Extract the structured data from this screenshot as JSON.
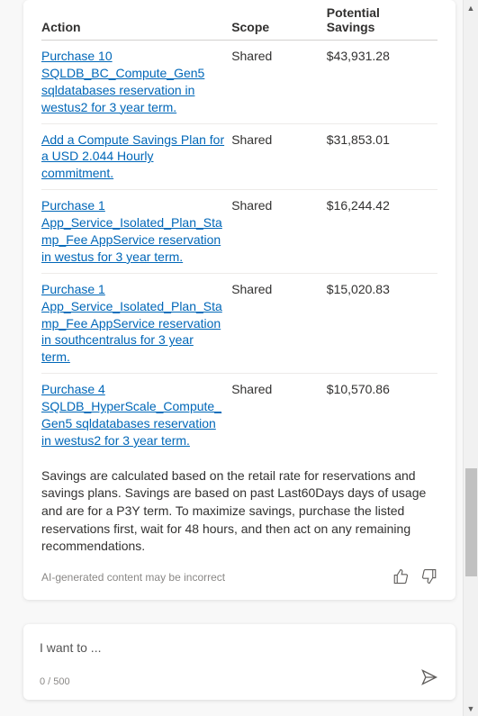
{
  "table": {
    "headers": {
      "action": "Action",
      "scope": "Scope",
      "savings": "Potential Savings"
    },
    "rows": [
      {
        "action": "Purchase 10 SQLDB_BC_Compute_Gen5 sqldatabases reservation in westus2 for 3 year term.",
        "scope": "Shared",
        "savings": "$43,931.28"
      },
      {
        "action": "Add a Compute Savings Plan for a USD 2.044 Hourly commitment.",
        "scope": "Shared",
        "savings": "$31,853.01"
      },
      {
        "action": "Purchase 1 App_Service_Isolated_Plan_Stamp_Fee AppService reservation in westus for 3 year term.",
        "scope": "Shared",
        "savings": "$16,244.42"
      },
      {
        "action": "Purchase 1 App_Service_Isolated_Plan_Stamp_Fee AppService reservation in southcentralus for 3 year term.",
        "scope": "Shared",
        "savings": "$15,020.83"
      },
      {
        "action": "Purchase 4 SQLDB_HyperScale_Compute_Gen5 sqldatabases reservation in westus2 for 3 year term.",
        "scope": "Shared",
        "savings": "$10,570.86"
      }
    ]
  },
  "note": "Savings are calculated based on the retail rate for reservations and savings plans. Savings are based on past Last60Days days of usage and are for a P3Y term. To maximize savings, purchase the listed reservations first, wait for 48 hours, and then act on any remaining recommendations.",
  "disclaimer": "AI-generated content may be incorrect",
  "input": {
    "placeholder": "I want to ...",
    "counter": "0 / 500"
  }
}
